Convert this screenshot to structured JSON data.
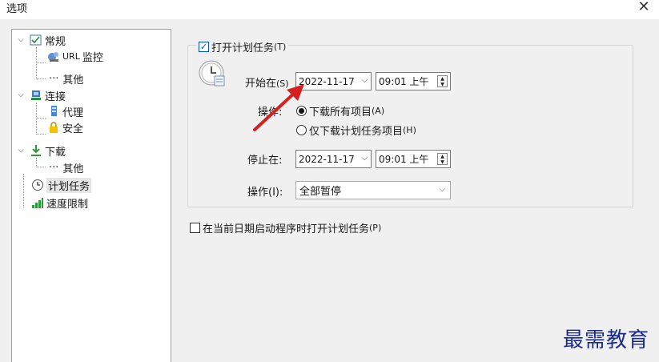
{
  "window": {
    "title": "选项",
    "close": "✕"
  },
  "tree": [
    {
      "id": "general",
      "label": "常规",
      "icon": "general-check-icon",
      "expanded": true
    },
    {
      "id": "url",
      "label_prefix": "URL",
      "label": "监控",
      "icon": "url-monitor-icon"
    },
    {
      "id": "general-other",
      "label": "其他"
    },
    {
      "id": "connection",
      "label": "连接",
      "icon": "connection-icon",
      "expanded": true
    },
    {
      "id": "proxy",
      "label": "代理",
      "icon": "proxy-icon"
    },
    {
      "id": "security",
      "label": "安全",
      "icon": "lock-icon"
    },
    {
      "id": "download",
      "label": "下载",
      "icon": "download-arrow-icon",
      "expanded": true
    },
    {
      "id": "download-other",
      "label": "其他"
    },
    {
      "id": "scheduler",
      "label": "计划任务",
      "icon": "clock-icon",
      "selected": true
    },
    {
      "id": "speed",
      "label": "速度限制",
      "icon": "speed-bars-icon"
    }
  ],
  "scheduler": {
    "enable_label": "打开计划任务",
    "enable_accel": "(T)",
    "enable_checked": true,
    "start_label": "开始在",
    "start_accel": "(S)",
    "start_date": "2022-11-17",
    "start_time": "09:01 上午",
    "action_label": "操作:",
    "radio_all": "下载所有项目",
    "radio_all_accel": "(A)",
    "radio_scheduled": "仅下载计划任务项目",
    "radio_scheduled_accel": "(H)",
    "selected_radio": "all",
    "stop_label": "停止在:",
    "stop_date": "2022-11-17",
    "stop_time": "09:01 上午",
    "stop_action_label": "操作(I):",
    "stop_action_value": "全部暂停",
    "startup_label": "在当前日期启动程序时打开计划任务",
    "startup_accel": "(P)",
    "startup_checked": false
  },
  "watermark": "最需教育",
  "colors": {
    "accent": "#0050c8",
    "arrow": "#d42020",
    "watermark": "#1a2b8c"
  }
}
